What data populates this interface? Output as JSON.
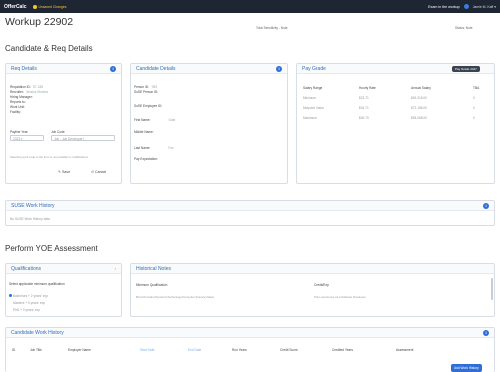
{
  "topbar": {
    "app_name": "OfferCalc",
    "action_label": "Unsaved Changes",
    "user_status": "Exam in the workup",
    "user_link": "Jamie M. Kaff ▾"
  },
  "page": {
    "title": "Workup 22902",
    "candidate_section_title": "Candidate & Req Details",
    "assessment_section_title": "Perform YOE Assessment",
    "meta_left": "Total Sensitivity - Note",
    "meta_right": "Status: Note"
  },
  "req_details": {
    "title": "Req Details",
    "fields": [
      {
        "label": "Requisition ID:",
        "value": "ST-188"
      },
      {
        "label": "Recruiter:",
        "value": "Jessica Moreno"
      },
      {
        "label": "Hiring Manager:",
        "value": ""
      },
      {
        "label": "Reports to:",
        "value": ""
      },
      {
        "label": "Work Unit:",
        "value": ""
      },
      {
        "label": "Facility:",
        "value": ""
      }
    ],
    "payline_label": "Payline Year",
    "job_code_label": "Job Code",
    "select_value": "2023 ▾",
    "job_code_value": "Job - Job Developer I",
    "note": "Selecting a job code to the form is not possible in modifications",
    "save_label": "Save",
    "cancel_label": "Cancel"
  },
  "candidate_details": {
    "title": "Candidate Details",
    "fields": [
      {
        "label": "Person ID:",
        "value": "TBS"
      },
      {
        "label": "SuSE Person ID:",
        "value": ""
      },
      {
        "label": "SuSE Employee ID:",
        "value": ""
      },
      {
        "label": "First Name:",
        "value": "Gale"
      },
      {
        "label": "Middle Name:",
        "value": ""
      },
      {
        "label": "Last Name:",
        "value": "Fox"
      },
      {
        "label": "Pay Expectation:",
        "value": ""
      }
    ]
  },
  "pay_grade": {
    "title": "Pay Grade",
    "button_label": "Pay Grade 4427",
    "columns": [
      "Salary Range",
      "Hourly Rate",
      "Annual Salary",
      "TBA"
    ],
    "rows": [
      [
        "Minimum",
        "$23.71",
        "$49,318.00",
        "0"
      ],
      [
        "Midpoint Value",
        "$34.71",
        "$72,188.00",
        "0"
      ],
      [
        "Maximum",
        "$45.70",
        "$95,068.00",
        "0"
      ]
    ]
  },
  "suse_work_history": {
    "title": "SUSE Work History",
    "empty_text": "No SUSE Work History data"
  },
  "qualifications": {
    "title": "Qualifications",
    "instruction": "Select applicable minimum qualification",
    "options": [
      "Bachelors + 2 years' exp",
      "Masters + 0 years' exp",
      "PhD + 0 years' exp"
    ]
  },
  "historical_notes": {
    "title": "Historical Notes",
    "col1": "Minimum Qualification",
    "col2": "Credit/Exp",
    "row_col1": "BA (Information/Systems/Technology/Computer Science) Major",
    "row_col2": "Prior experience as a Software Developer"
  },
  "candidate_work_history": {
    "title": "Candidate Work History",
    "columns": [
      "ID",
      "Job Title",
      "Employer Name",
      "Start Date",
      "End Date",
      "Run Years",
      "Credit Score",
      "Credited Years",
      "Assessment"
    ],
    "add_button": "Add Work History"
  }
}
